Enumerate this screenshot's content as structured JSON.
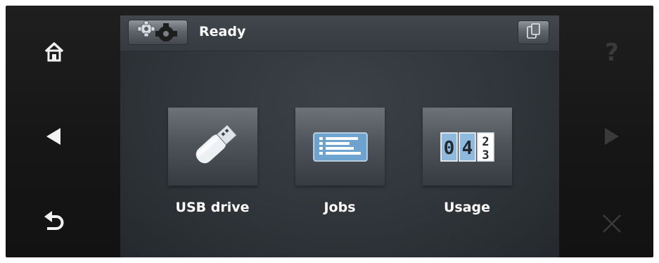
{
  "status": {
    "text": "Ready"
  },
  "icons": {
    "home": "home-icon",
    "back_nav": "left-arrow-icon",
    "undo": "back-return-icon",
    "help": "help-icon",
    "forward_nav": "right-arrow-icon",
    "cancel": "close-icon",
    "settings": "settings-gears-icon",
    "device": "device-info-icon"
  },
  "help_glyph": "?",
  "apps": [
    {
      "label": "USB drive",
      "icon": "usb-drive-icon"
    },
    {
      "label": "Jobs",
      "icon": "jobs-list-icon"
    },
    {
      "label": "Usage",
      "icon": "usage-counter-icon",
      "counter_digits": [
        "0",
        "4",
        "2",
        "3"
      ]
    }
  ],
  "colors": {
    "bezel": "#161616",
    "screen": "#30353a",
    "tile_top": "#6c7278",
    "icon_blue": "#6fa3cf",
    "text": "#ffffff"
  }
}
